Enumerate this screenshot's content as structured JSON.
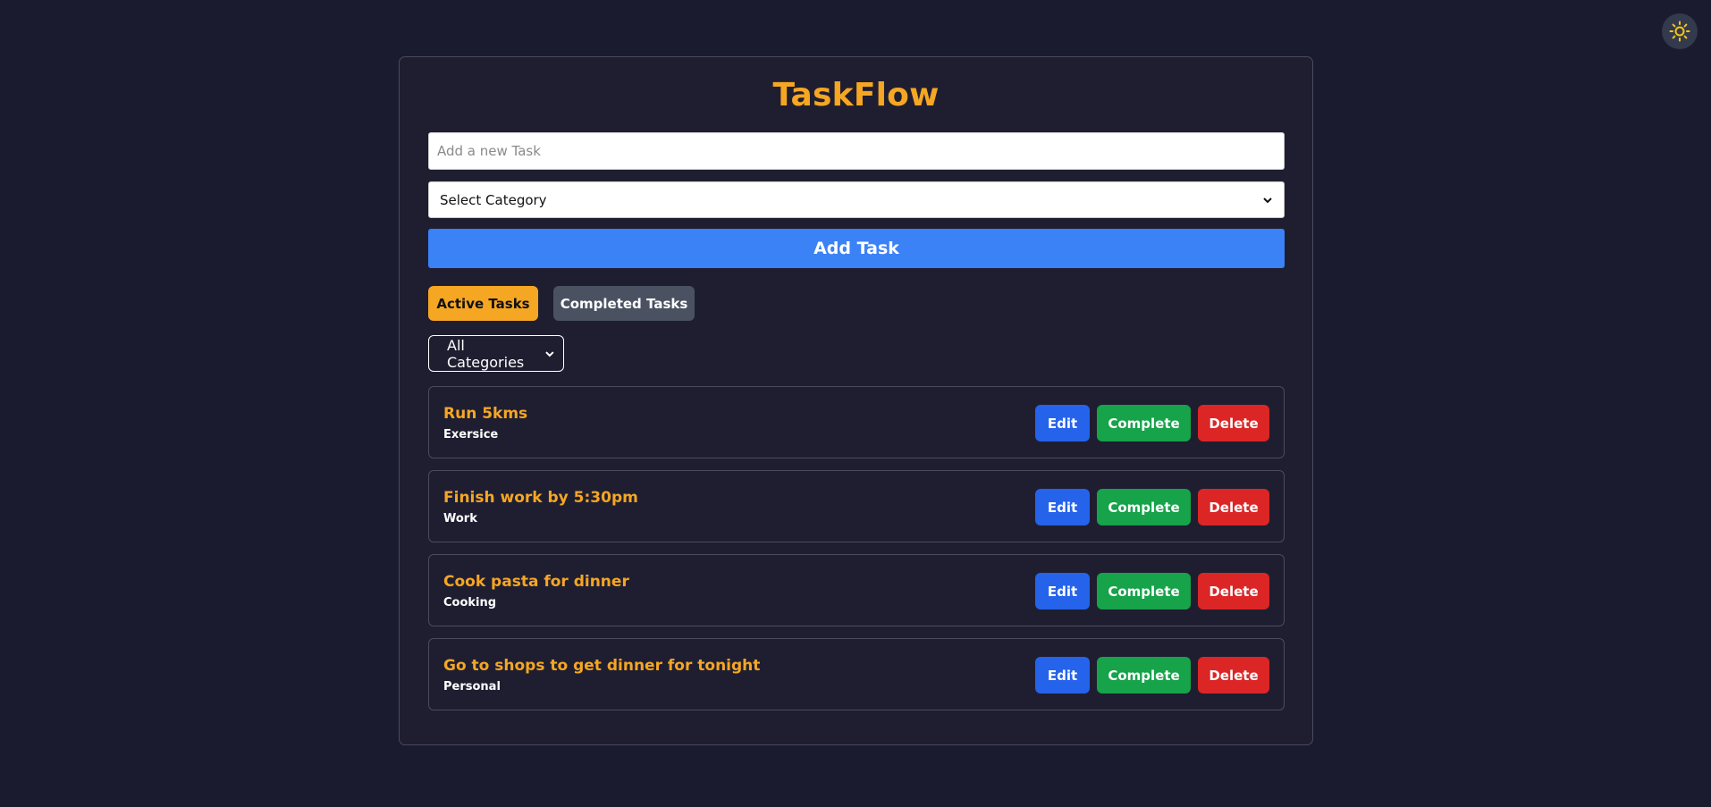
{
  "app": {
    "title": "TaskFlow",
    "theme_toggle_icon": "sun-icon"
  },
  "form": {
    "task_input_value": "",
    "task_input_placeholder": "Add a new Task",
    "category_select_value": "Select Category",
    "add_button_label": "Add Task"
  },
  "tabs": {
    "active_label": "Active Tasks",
    "completed_label": "Completed Tasks",
    "selected": "Active Tasks"
  },
  "filter": {
    "value": "All Categories"
  },
  "task_actions": {
    "edit_label": "Edit",
    "complete_label": "Complete",
    "delete_label": "Delete"
  },
  "tasks": [
    {
      "title": "Run 5kms",
      "category": "Exersice"
    },
    {
      "title": "Finish work by 5:30pm",
      "category": "Work"
    },
    {
      "title": "Cook pasta for dinner",
      "category": "Cooking"
    },
    {
      "title": "Go to shops to get dinner for tonight",
      "category": "Personal"
    }
  ],
  "colors": {
    "background": "#1b1b30",
    "card": "#1f1e31",
    "accent": "#f5a623",
    "primary_blue": "#3b82f6",
    "edit_blue": "#2563eb",
    "complete_green": "#16a34a",
    "delete_red": "#dc2626",
    "tab_gray": "#4a5262"
  }
}
